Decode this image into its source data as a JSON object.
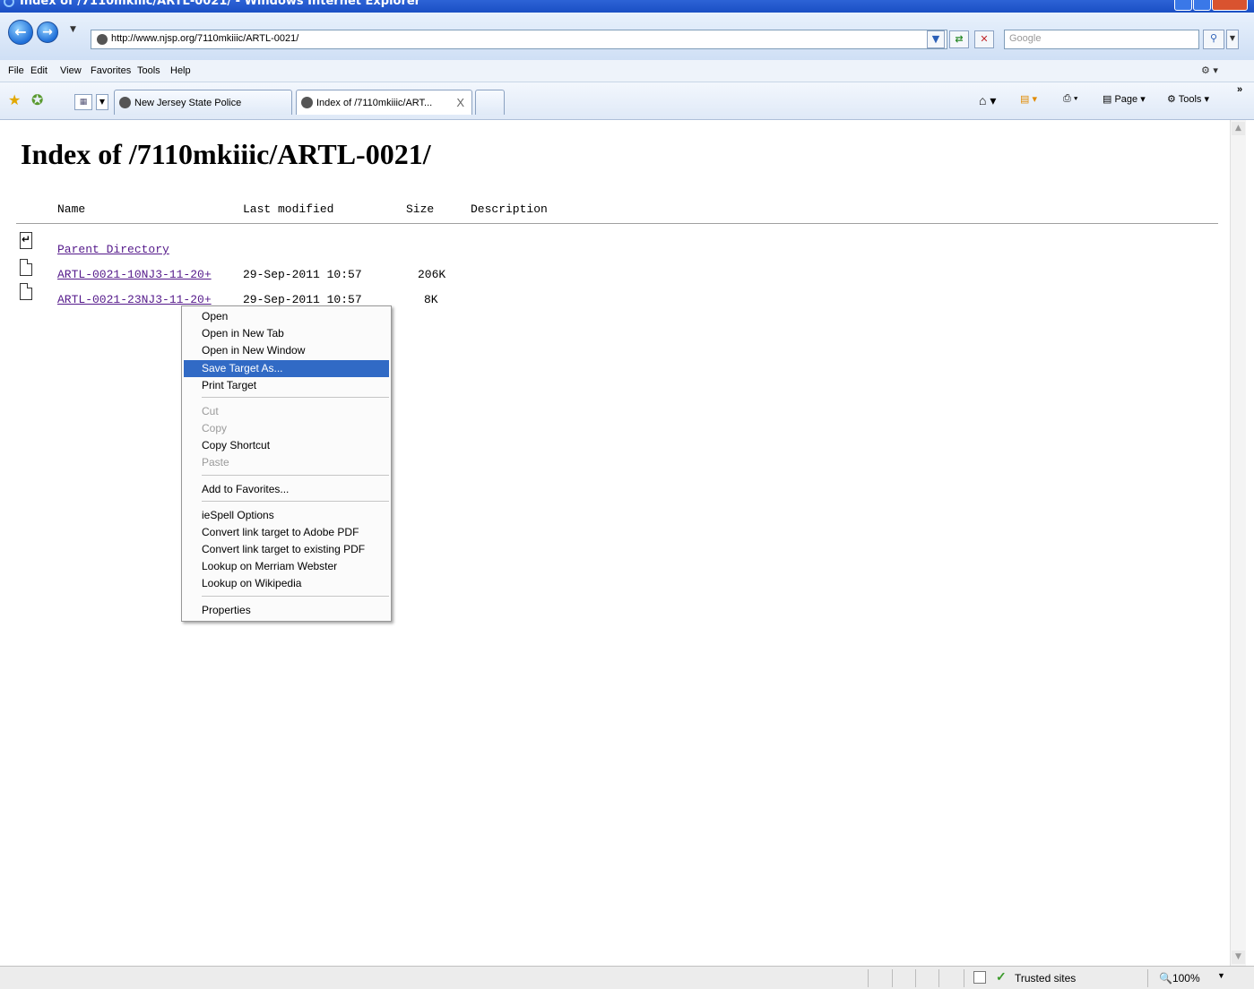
{
  "window": {
    "title": "Index of /7110mkiiic/ARTL-0021/ - Windows Internet Explorer"
  },
  "address": {
    "url": "http://www.njsp.org/7110mkiiic/ARTL-0021/"
  },
  "search": {
    "placeholder": "Google"
  },
  "menubar": [
    "File",
    "Edit",
    "View",
    "Favorites",
    "Tools",
    "Help"
  ],
  "tabs": [
    {
      "label": "New Jersey State Police"
    },
    {
      "label": "Index of /7110mkiiic/ART...",
      "close": "X"
    }
  ],
  "command_bar": {
    "page": "Page",
    "tools": "Tools"
  },
  "page": {
    "heading": "Index of /7110mkiiic/ARTL-0021/",
    "columns": [
      "Name",
      "Last modified",
      "Size",
      "Description"
    ],
    "rows": [
      {
        "name": "Parent Directory",
        "modified": "",
        "size": ""
      },
      {
        "name": "ARTL-0021-10NJ3-11-20+",
        "modified": "29-Sep-2011 10:57",
        "size": "206K"
      },
      {
        "name": "ARTL-0021-23NJ3-11-20+",
        "modified": "29-Sep-2011 10:57",
        "size": "8K"
      }
    ]
  },
  "context_menu": {
    "items": [
      {
        "label": "Open",
        "enabled": true
      },
      {
        "label": "Open in New Tab",
        "enabled": true
      },
      {
        "label": "Open in New Window",
        "enabled": true
      },
      {
        "label": "Save Target As...",
        "enabled": true,
        "highlighted": true
      },
      {
        "label": "Print Target",
        "enabled": true
      },
      {
        "label": "Cut",
        "enabled": false
      },
      {
        "label": "Copy",
        "enabled": false
      },
      {
        "label": "Copy Shortcut",
        "enabled": true
      },
      {
        "label": "Paste",
        "enabled": false
      },
      {
        "label": "Add to Favorites...",
        "enabled": true
      },
      {
        "label": "ieSpell Options",
        "enabled": true
      },
      {
        "label": "Convert link target to Adobe PDF",
        "enabled": true
      },
      {
        "label": "Convert link target to existing PDF",
        "enabled": true
      },
      {
        "label": "Lookup on Merriam Webster",
        "enabled": true
      },
      {
        "label": "Lookup on Wikipedia",
        "enabled": true
      },
      {
        "label": "Properties",
        "enabled": true
      }
    ]
  },
  "status": {
    "zone": "Trusted sites",
    "zoom": "100%"
  },
  "colors": {
    "link_visited": "#551a8b",
    "menu_highlight": "#316ac5",
    "title_bar": "#1a4fc4"
  }
}
